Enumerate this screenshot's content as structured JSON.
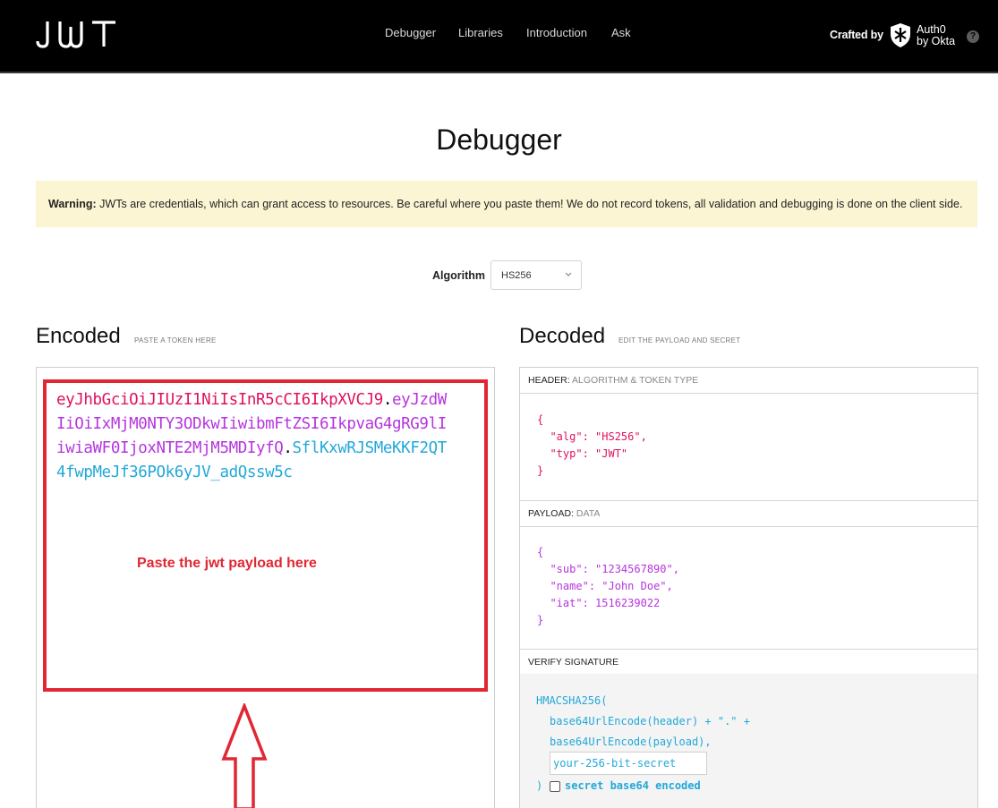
{
  "nav": {
    "logo_alt": "JWT",
    "links": [
      "Debugger",
      "Libraries",
      "Introduction",
      "Ask"
    ],
    "crafted_by": "Crafted by",
    "auth0_line1": "Auth0",
    "auth0_line2": "by Okta",
    "help": "?"
  },
  "page": {
    "title": "Debugger",
    "warning_bold": "Warning:",
    "warning_text": " JWTs are credentials, which can grant access to resources. Be careful where you paste them! We do not record tokens, all validation and debugging is done on the client side."
  },
  "algorithm": {
    "label": "Algorithm",
    "selected": "HS256"
  },
  "encoded": {
    "title": "Encoded",
    "subtitle": "PASTE A TOKEN HERE",
    "token_header": "eyJhbGciOiJIUzI1NiIsInR5cCI6IkpXVCJ9",
    "dot1": ".",
    "token_payload": "eyJzdWIiOiIxMjM0NTY3ODkwIiwibmFtZSI6IkpvaG4gRG9lIiwiaWF0IjoxNTE2MjM5MDIyfQ",
    "dot2": ".",
    "token_signature": "SflKxwRJSMeKKF2QT4fwpMeJf36POk6yJV_adQssw5c",
    "annotation": "Paste the jwt payload here"
  },
  "decoded": {
    "title": "Decoded",
    "subtitle": "EDIT THE PAYLOAD AND SECRET",
    "header_label": "HEADER:",
    "header_sub": "ALGORITHM & TOKEN TYPE",
    "header_json": {
      "open": "{",
      "alg_key": "\"alg\"",
      "alg_val": "\"HS256\"",
      "typ_key": "\"typ\"",
      "typ_val": "\"JWT\"",
      "close": "}"
    },
    "payload_label": "PAYLOAD:",
    "payload_sub": "DATA",
    "payload_json": {
      "open": "{",
      "sub_key": "\"sub\"",
      "sub_val": "\"1234567890\"",
      "name_key": "\"name\"",
      "name_val": "\"John Doe\"",
      "iat_key": "\"iat\"",
      "iat_val": "1516239022",
      "close": "}"
    },
    "verify_label": "VERIFY SIGNATURE",
    "sig_fn": "HMACSHA256(",
    "sig_line1": "base64UrlEncode(header) + \".\" +",
    "sig_line2": "base64UrlEncode(payload),",
    "secret_placeholder": "your-256-bit-secret",
    "sig_close": ")",
    "b64_label": "secret base64 encoded"
  },
  "colors": {
    "header_red": "#e0115f",
    "payload_purple": "#b634df",
    "signature_blue": "#22a8d8",
    "annotation_red": "#e12733"
  }
}
